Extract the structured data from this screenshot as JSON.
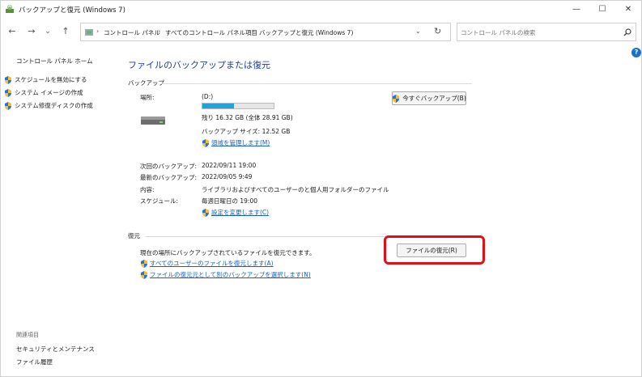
{
  "window": {
    "title": "バックアップと復元 (Windows 7)",
    "minimize_glyph": "—",
    "maximize_glyph": "☐",
    "close_glyph": "✕"
  },
  "nav": {
    "back_glyph": "←",
    "forward_glyph": "→",
    "history_glyph": "⌄",
    "up_glyph": "↑",
    "breadcrumbs": [
      "コントロール パネル",
      "すべてのコントロール パネル項目",
      "バックアップと復元 (Windows 7)"
    ],
    "separator": "›",
    "dropdown_glyph": "⌄",
    "refresh_glyph": "↻"
  },
  "search": {
    "placeholder": "コントロール パネルの検索"
  },
  "help": {
    "glyph": "?"
  },
  "left_pane": {
    "home": "コントロール パネル ホーム",
    "tasks": [
      "スケジュールを無効にする",
      "システム イメージの作成",
      "システム修復ディスクの作成"
    ],
    "see_also_heading": "関連項目",
    "see_also": [
      "セキュリティとメンテナンス",
      "ファイル履歴"
    ]
  },
  "main": {
    "title": "ファイルのバックアップまたは復元",
    "backup": {
      "section_label": "バックアップ",
      "location_label": "場所:",
      "drive": "(D:)",
      "usage_fraction": 0.44,
      "free_text": "残り 16.32 GB (全体 28.91 GB)",
      "backup_size_text": "バックアップ サイズ: 12.52 GB",
      "manage_space_link": "領域を管理します(M)",
      "backup_now_button": "今すぐバックアップ(B)",
      "details": [
        {
          "label": "次回のバックアップ:",
          "value": "2022/09/11 19:00"
        },
        {
          "label": "最新のバックアップ:",
          "value": "2022/09/05 9:49"
        },
        {
          "label": "内容:",
          "value": "ライブラリおよびすべてのユーザーのと個人用フォルダーのファイル"
        },
        {
          "label": "スケジュール:",
          "value": "毎週日曜日の 19:00"
        }
      ],
      "change_settings_link": "設定を変更します(C)"
    },
    "restore": {
      "section_label": "復元",
      "description": "現在の場所にバックアップされているファイルを復元できます。",
      "restore_all_users_link": "すべてのユーザーのファイルを復元します(A)",
      "select_other_backup_link": "ファイルの復元元として別のバックアップを選択します(N)",
      "restore_files_button": "ファイルの復元(R)"
    }
  },
  "colors": {
    "title_blue": "#1e3f8f",
    "link_blue": "#1a5fc2",
    "progress_fill": "#26a0da",
    "highlight_red": "#e0101a"
  }
}
